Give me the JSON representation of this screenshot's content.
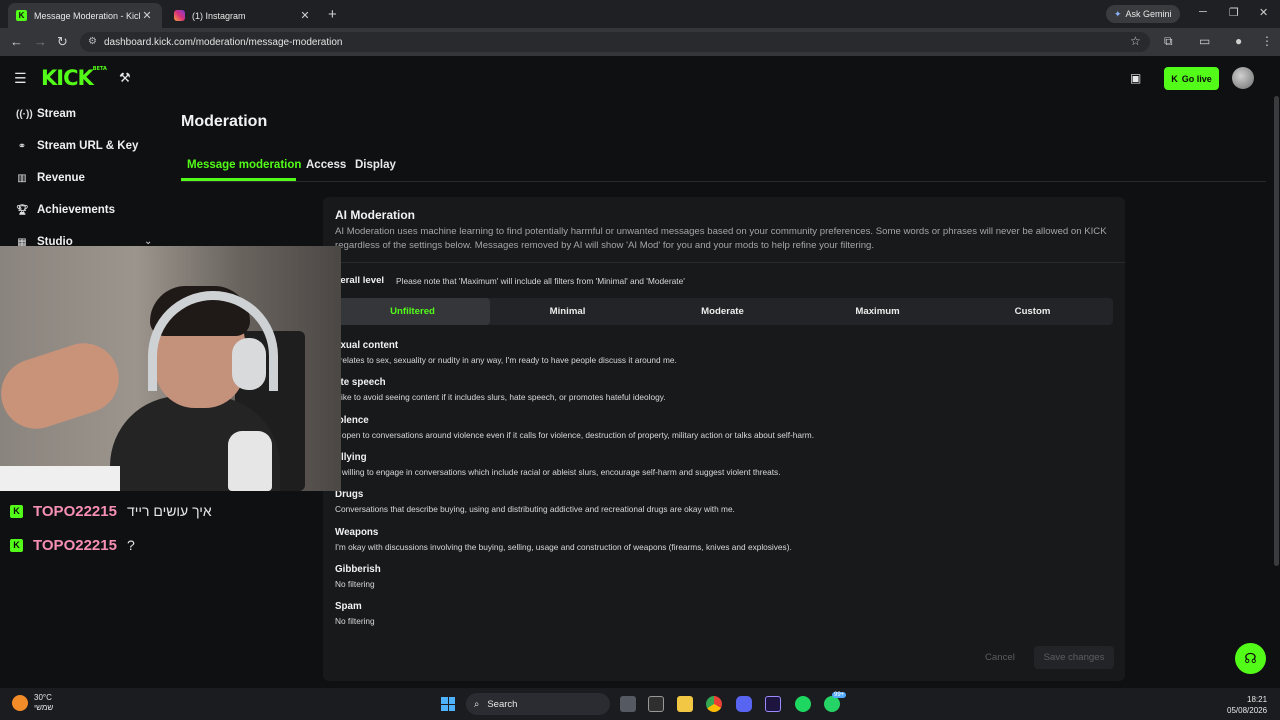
{
  "browser": {
    "tabs": [
      {
        "title": "Message Moderation - Kick Da",
        "icon": "kick-icon",
        "active": true
      },
      {
        "title": "(1) Instagram",
        "icon": "instagram-icon",
        "active": false
      }
    ],
    "new_tab": "+",
    "ask_gemini": "Ask Gemini",
    "url": "dashboard.kick.com/moderation/message-moderation"
  },
  "header": {
    "logo": "KICK",
    "logo_badge": "BETA",
    "go_live": "Go live",
    "accent": "#53fc18"
  },
  "sidebar": {
    "items": [
      {
        "label": "Stream",
        "icon": "broadcast-icon"
      },
      {
        "label": "Stream URL & Key",
        "icon": "link-icon"
      },
      {
        "label": "Revenue",
        "icon": "chart-icon"
      },
      {
        "label": "Achievements",
        "icon": "trophy-icon"
      },
      {
        "label": "Studio",
        "icon": "studio-icon"
      }
    ]
  },
  "main": {
    "title": "Moderation",
    "tabs": [
      "Message moderation",
      "Access",
      "Display"
    ],
    "card": {
      "title": "AI Moderation",
      "description": "AI Moderation uses machine learning to find potentially harmful or unwanted messages based on your community preferences. Some words or phrases will never be allowed on KICK regardless of the settings below. Messages removed by AI will show 'AI Mod' for you and your mods to help refine your filtering.",
      "overall_label": "verall level",
      "overall_note": "Please note that 'Maximum' will include all filters from 'Minimal' and 'Moderate'",
      "levels": [
        "Unfiltered",
        "Minimal",
        "Moderate",
        "Maximum",
        "Custom"
      ],
      "selected_level": "Unfiltered",
      "categories": [
        {
          "name": "exual content",
          "desc": "t relates to sex, sexuality or nudity in any way, I'm ready to have people discuss it around me."
        },
        {
          "name": "ate speech",
          "desc": "l like to avoid seeing content if it includes slurs, hate speech, or promotes hateful ideology."
        },
        {
          "name": "iolence",
          "desc": "n open to conversations around violence even if it calls for violence, destruction of property, military action or talks about self-harm."
        },
        {
          "name": "ullying",
          "desc": "n willing to engage in conversations which include racial or ableist slurs, encourage self-harm and suggest violent threats."
        },
        {
          "name": "Drugs",
          "desc": "Conversations that describe buying, using and distributing addictive and recreational drugs are okay with me."
        },
        {
          "name": "Weapons",
          "desc": "I'm okay with discussions involving the buying, selling, usage and construction of weapons (firearms, knives and explosives)."
        },
        {
          "name": "Gibberish",
          "desc": "No filtering"
        },
        {
          "name": "Spam",
          "desc": "No filtering"
        }
      ],
      "cancel": "Cancel",
      "save": "Save changes"
    }
  },
  "chat": [
    {
      "user": "TOPO22215",
      "message": "איך עושים רייד"
    },
    {
      "user": "TOPO22215",
      "message": "?"
    }
  ],
  "taskbar": {
    "temperature": "30°C",
    "weather_sub": "שמשי",
    "search": "Search",
    "time": "18:21",
    "date": "05/08/2026",
    "notification_badge": "99+"
  }
}
